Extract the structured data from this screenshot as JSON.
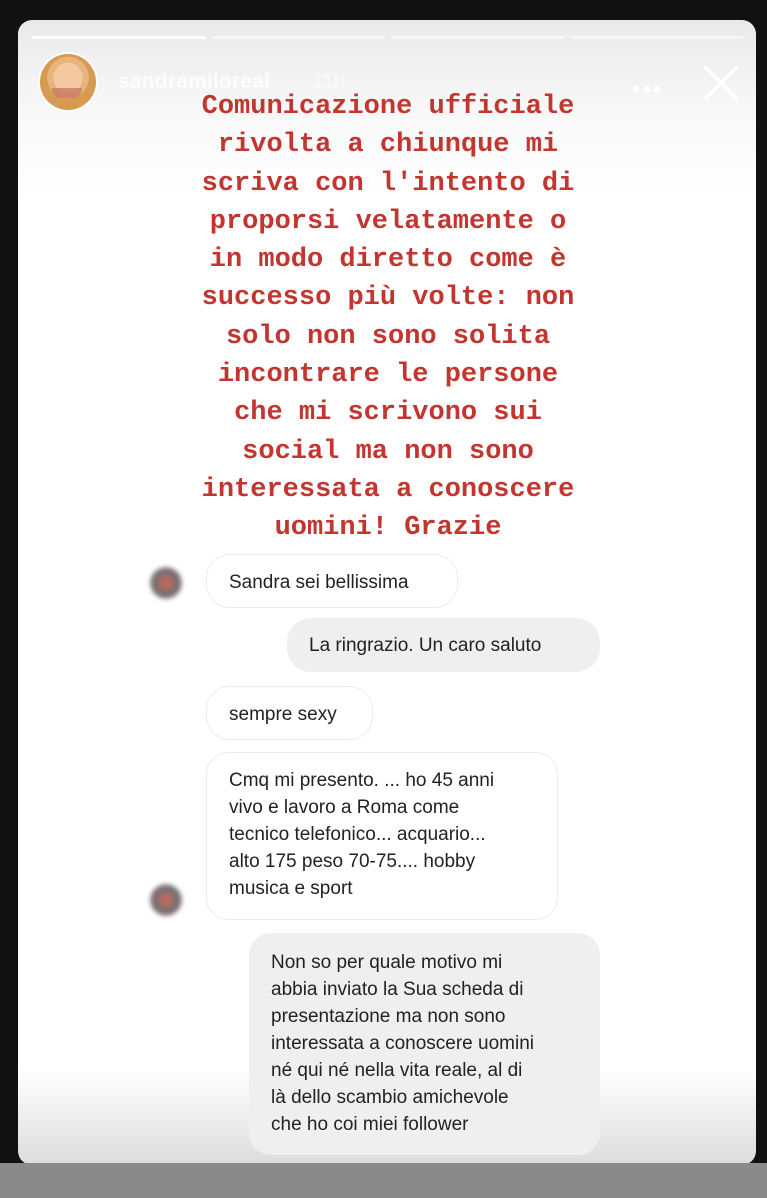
{
  "story": {
    "username": "sandramiloreal",
    "time": "11h",
    "more_icon": "more-horizontal-icon",
    "close_icon": "close-icon",
    "progress_segments": 4,
    "progress_done": 1,
    "caption": "Comunicazione ufficiale\nrivolta a chiunque mi\nscriva con l'intento di\nproporsi velatamente o\nin modo diretto come è\nsuccesso più volte: non\nsolo non sono solita\nincontrare le persone\nche mi scrivono sui\nsocial ma non sono\ninteressata a conoscere\nuomini! Grazie",
    "caption_color": "#c2362f"
  },
  "messages": [
    {
      "side": "in",
      "text": "Sandra sei bellissima"
    },
    {
      "side": "out",
      "text": "La ringrazio. Un caro saluto"
    },
    {
      "side": "in",
      "text": "sempre sexy"
    },
    {
      "side": "in",
      "text": "Cmq mi presento. ... ho 45 anni\nvivo e lavoro a Roma come\ntecnico telefonico... acquario...\nalto 175 peso 70-75.... hobby\nmusica e sport"
    },
    {
      "side": "out",
      "text": "Non so per quale motivo mi\nabbia inviato la Sua scheda di\npresentazione ma non sono\ninteressata a conoscere uomini\nné qui né nella vita reale, al di\nlà dello scambio amichevole\nche ho coi miei follower"
    }
  ]
}
